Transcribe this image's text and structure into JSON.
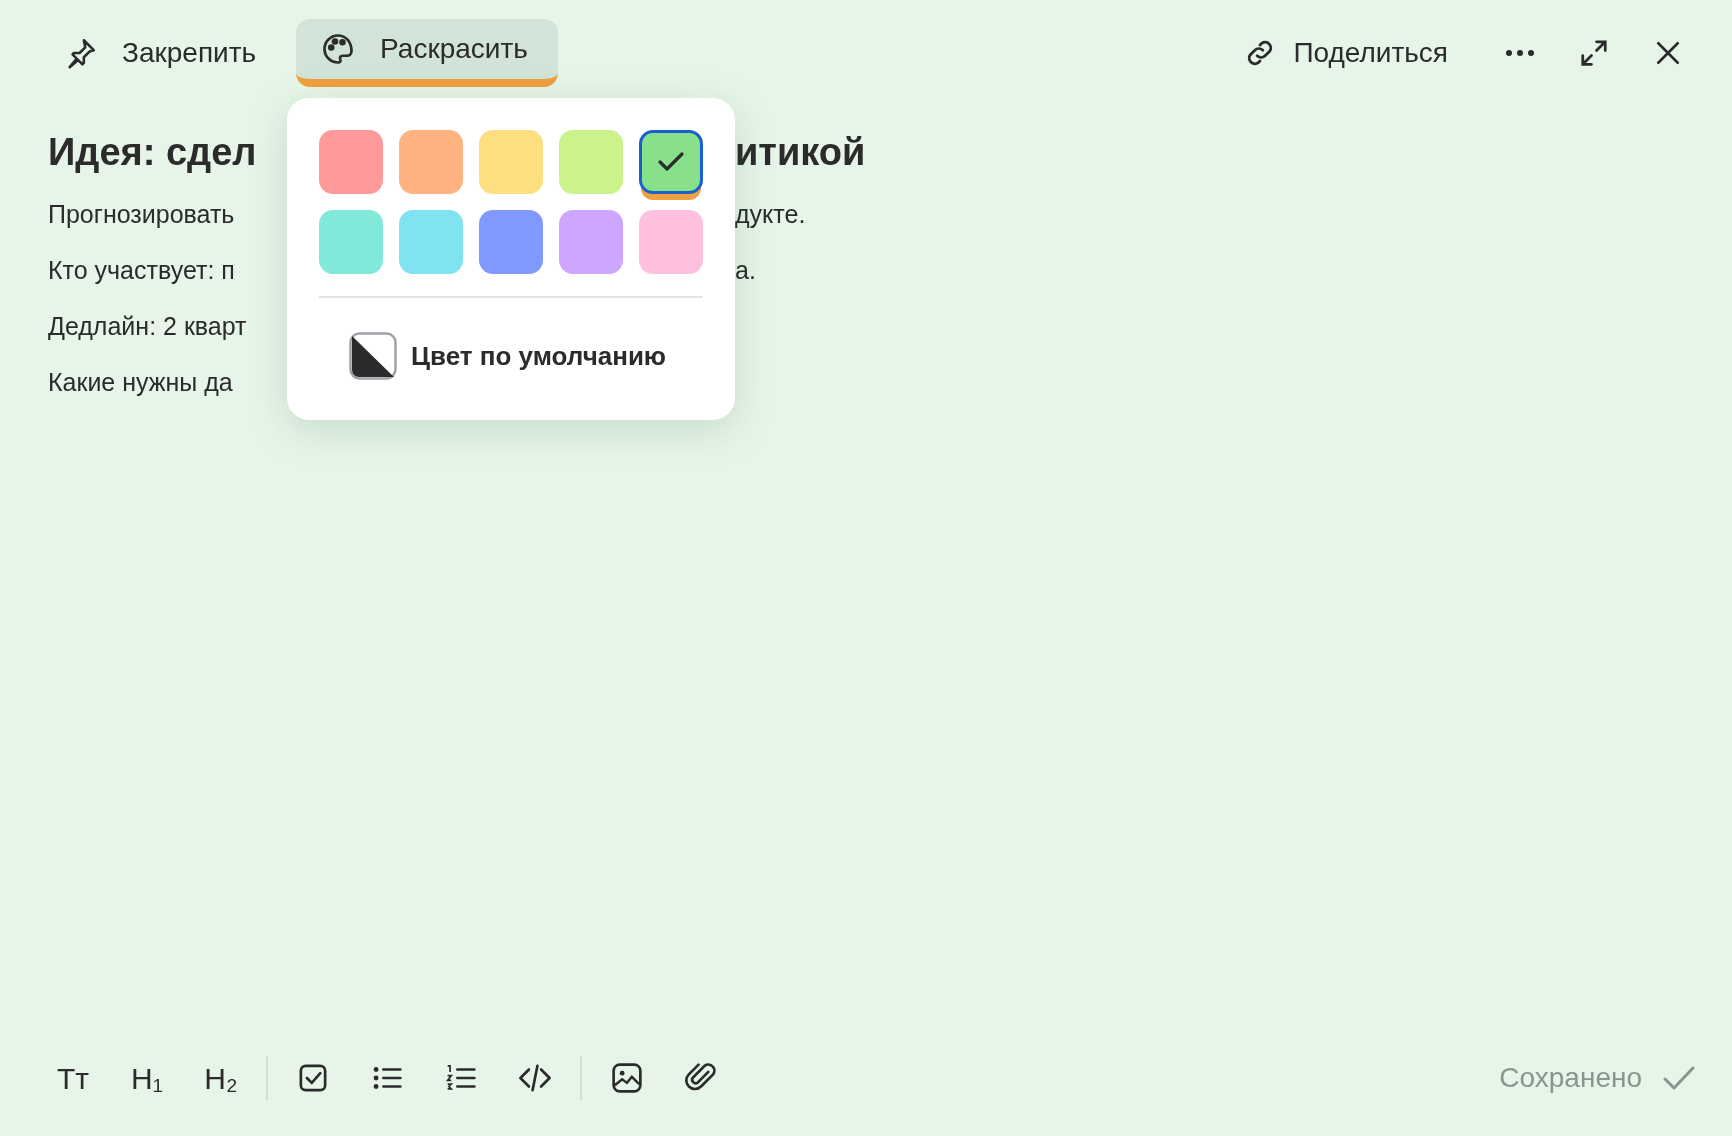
{
  "top_bar": {
    "actions": [
      {
        "kind": "pin",
        "label": "Закрепить",
        "selected": false
      },
      {
        "kind": "palette",
        "label": "Раскрасить",
        "selected": true
      }
    ],
    "share": {
      "label": "Поделиться"
    }
  },
  "note": {
    "title": {
      "left": "Идея: сдел",
      "right": "итикой"
    },
    "lines": [
      {
        "left": "Прогнозировать",
        "right": "дукте."
      },
      {
        "left": "Кто участвует: п",
        "right": "а."
      },
      {
        "left": "Дедлайн: 2 кварт"
      },
      {
        "left": "Какие нужны да"
      }
    ]
  },
  "color_picker": {
    "swatches": [
      {
        "color": "#ff9a9a",
        "selected": false
      },
      {
        "color": "#ffb380",
        "selected": false
      },
      {
        "color": "#ffde80",
        "selected": false
      },
      {
        "color": "#ccf28c",
        "selected": false
      },
      {
        "color": "#88e08a",
        "selected": true
      },
      {
        "color": "#80e9da",
        "selected": false
      },
      {
        "color": "#80e3f2",
        "selected": false
      },
      {
        "color": "#8099ff",
        "selected": false
      },
      {
        "color": "#cca6ff",
        "selected": false
      },
      {
        "color": "#ffc0e0",
        "selected": false
      }
    ],
    "default_option": {
      "label": "Цвет по умолчанию"
    }
  },
  "editor_toolbar": {
    "groups": [
      [
        {
          "kind": "text",
          "label": "Тт"
        },
        {
          "kind": "text",
          "label": "H₁"
        },
        {
          "kind": "text",
          "label": "H₂"
        }
      ],
      [
        {
          "kind": "checkbox"
        },
        {
          "kind": "bullets"
        },
        {
          "kind": "numbers"
        },
        {
          "kind": "code"
        }
      ],
      [
        {
          "kind": "image"
        },
        {
          "kind": "attach"
        }
      ]
    ]
  },
  "status": {
    "label": "Сохранено"
  }
}
